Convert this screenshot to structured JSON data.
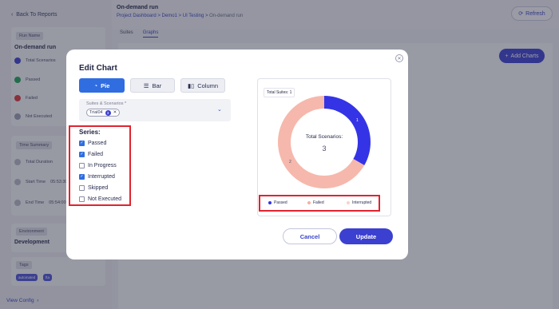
{
  "sidebar": {
    "back_label": "Back To Reports",
    "run_name_label": "Run Name",
    "run_name_value": "On-demand run",
    "items": [
      {
        "label": "Total Scenarios",
        "color": "#3b40d0"
      },
      {
        "label": "Passed",
        "color": "#1fa35a"
      },
      {
        "label": "Failed",
        "color": "#d9373c"
      },
      {
        "label": "Not Executed",
        "color": "#9a9db3"
      }
    ],
    "time_summary_label": "Time Summary",
    "time_items": [
      {
        "label": "Total Duration",
        "value": ""
      },
      {
        "label": "Start Time",
        "value": "05:53:30"
      },
      {
        "label": "End Time",
        "value": "05:54:00"
      }
    ],
    "environment_label": "Environment",
    "environment_value": "Development",
    "tags_label": "Tags",
    "tags": [
      "automated",
      "fta"
    ],
    "view_config": "View Config"
  },
  "header": {
    "title": "On-demand run",
    "breadcrumb": [
      "Project Dashboard",
      "Demo1",
      "UI Testing",
      "On-demand run"
    ],
    "refresh_label": "Refresh",
    "tabs": [
      {
        "label": "Suites",
        "active": false
      },
      {
        "label": "Graphs",
        "active": true
      }
    ],
    "add_charts_label": "Add Charts"
  },
  "modal": {
    "title": "Edit Chart",
    "chart_types": [
      {
        "label": "Pie",
        "icon": "refresh-pie-icon",
        "active": true
      },
      {
        "label": "Bar",
        "icon": "bar-lines-icon",
        "active": false
      },
      {
        "label": "Column",
        "icon": "column-icon",
        "active": false
      }
    ],
    "suites_field": {
      "label": "Suites & Scenarios *",
      "chip_text": "Trial04",
      "chip_count": "3"
    },
    "series_title": "Series:",
    "series": [
      {
        "label": "Passed",
        "checked": true
      },
      {
        "label": "Failed",
        "checked": true
      },
      {
        "label": "In Progress",
        "checked": false
      },
      {
        "label": "Interrupted",
        "checked": true
      },
      {
        "label": "Skipped",
        "checked": false
      },
      {
        "label": "Not Executed",
        "checked": false
      }
    ],
    "preview": {
      "total_suites_label": "Total Suites: 1",
      "center_label": "Total Scenarios:",
      "center_value": "3",
      "legend": [
        {
          "label": "Passed",
          "color": "#3434e6"
        },
        {
          "label": "Failed",
          "color": "#f6b0a4"
        },
        {
          "label": "Interrupted",
          "color": "#f9d3c4"
        }
      ]
    },
    "cancel_label": "Cancel",
    "update_label": "Update"
  },
  "chart_data": {
    "type": "pie",
    "title": "",
    "categories": [
      "Passed",
      "Failed"
    ],
    "values": [
      1,
      2
    ],
    "slice_labels": [
      "1",
      "2"
    ],
    "colors": [
      "#3434e6",
      "#f6b8ac"
    ],
    "center_text": "Total Scenarios:",
    "center_value": "3"
  }
}
